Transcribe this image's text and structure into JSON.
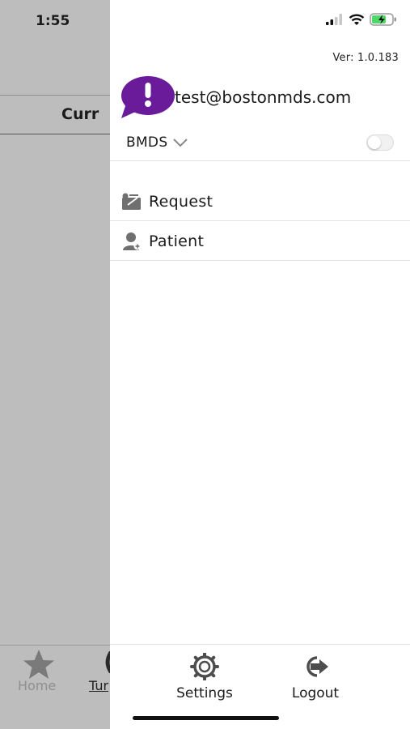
{
  "status_bar": {
    "time": "1:55"
  },
  "background_app": {
    "heading": "Curr",
    "tabs": [
      {
        "label": "Home",
        "icon": "star-icon"
      },
      {
        "label": "Tur",
        "icon": "clock-icon"
      }
    ]
  },
  "drawer": {
    "version": "Ver: 1.0.183",
    "user_email": "test@bostonmds.com",
    "organization": "BMDS",
    "menu": [
      {
        "label": "Request",
        "icon": "request-icon"
      },
      {
        "label": "Patient",
        "icon": "patient-icon"
      }
    ],
    "footer": [
      {
        "label": "Settings",
        "icon": "gear-icon"
      },
      {
        "label": "Logout",
        "icon": "logout-icon"
      }
    ]
  },
  "colors": {
    "brand_purple": "#6a1b9a",
    "overlay_gray": "#bdbdbd",
    "icon_gray": "#6f6f6f",
    "battery_green": "#4cd964"
  }
}
